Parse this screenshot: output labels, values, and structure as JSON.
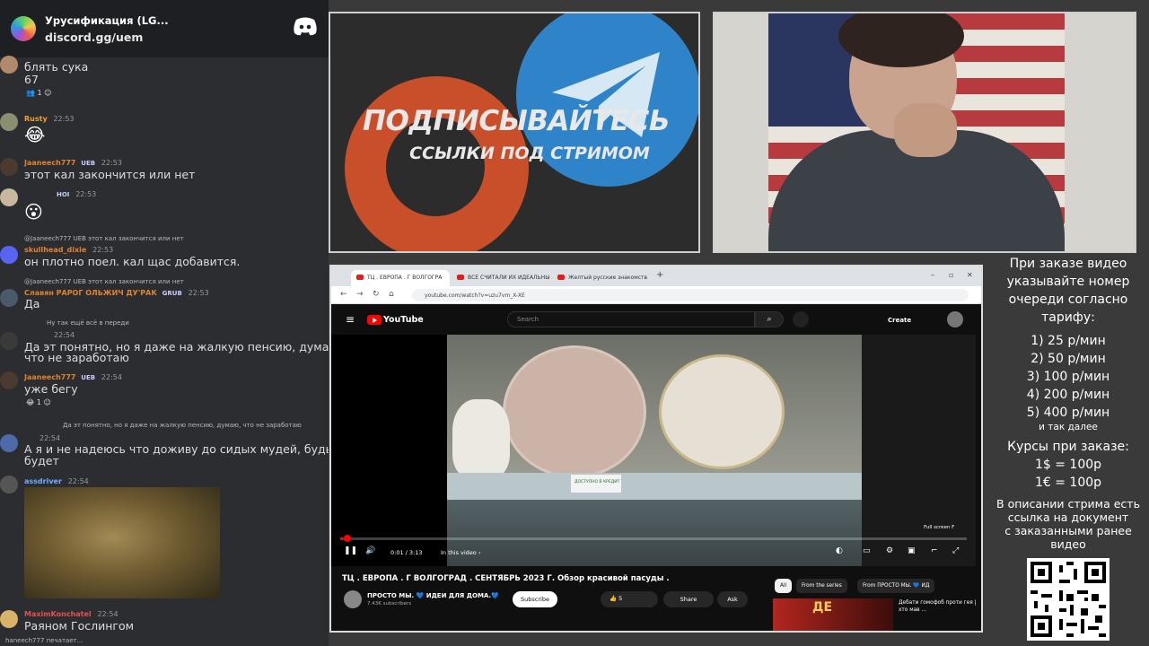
{
  "chat": {
    "server_name": "Урусификация (LG...",
    "server_link": "discord.gg/uem",
    "messages": [
      {
        "text1": "блять сука",
        "text2": "67",
        "react_count": "1"
      },
      {
        "author": "Rusty",
        "author_color": "#f0a030",
        "time": "22:53",
        "emoji": "😂"
      },
      {
        "author": "Jaaneech777",
        "badge": "UEB",
        "author_color": "#e0832f",
        "time": "22:53",
        "text": "этот кал закончится или нет"
      },
      {
        "badge": "HOI",
        "time": "22:53",
        "emoji": "😮"
      },
      {
        "reply": "@Jaaneech777 UEB этот кал закончится или нет",
        "author": "skullhead_dixie",
        "author_color": "#e0832f",
        "time": "22:53",
        "text": "он плотно поел. кал щас добавится."
      },
      {
        "reply": "@Jaaneech777 UEB этот кал закончится или нет",
        "author": "Славян РАРОГ ОЛЬЖИЧ ДУ'РАК",
        "badge": "GRUB",
        "author_color": "#e0832f",
        "time": "22:53",
        "text": "Да"
      },
      {
        "reply": "Ну так ещё всё в переди",
        "time": "22:54",
        "text1": "Да эт понятно, но я даже на жалкую пенсию, думаю,",
        "text2": "что не заработаю"
      },
      {
        "author": "Jaaneech777",
        "badge": "UEB",
        "author_color": "#e0832f",
        "time": "22:54",
        "text": "уже бегу",
        "react_count": "1"
      },
      {
        "reply": "Да эт понятно, но я даже на жалкую пенсию, думаю, что не заработаю",
        "time": "22:54",
        "text1": "А я и не надеюсь что доживу до сидых мудей, будь что",
        "text2": "будет"
      },
      {
        "author": "assdriver",
        "author_color": "#6fb0ff",
        "time": "22:54"
      },
      {
        "author": "MaximKonchatel",
        "author_color": "#e55050",
        "time": "22:54",
        "text": "Раяном Гослингом"
      }
    ],
    "typing": "haneech777 печатает..."
  },
  "promo": {
    "title": "ПОДПИСЫВАЙТЕСЬ",
    "subtitle": "ССЫЛКИ ПОД СТРИМОМ"
  },
  "browser": {
    "tabs": [
      "ТЦ . ЕВРОПА . Г ВОЛГОГРА",
      "ВСЕ СЧИТАЛИ ИХ ИДЕАЛЬНЫ",
      "Желтый русские знакомств"
    ],
    "url": "youtube.com/watch?v=uzu7vm_X-XE"
  },
  "youtube": {
    "logo_text": "YouTube",
    "search_placeholder": "Search",
    "create_label": "Create",
    "time": "0:01 / 3:13",
    "chapter": "In this video ›",
    "fullscreen_tip": "Full screen  F",
    "progress": 0.005,
    "video_title": "ТЦ . ЕВРОПА . Г ВОЛГОГРАД . СЕНТЯБРЬ 2023 Г. Обзор красивой пасуды .",
    "channel_name": "ПРОСТО МЫ. 💙 ИДЕИ ДЛЯ ДОМА.💙",
    "channel_subs": "7.43K subscribers",
    "subscribe_label": "Subscribe",
    "like_count": "5",
    "share_label": "Share",
    "ask_label": "Ask",
    "chips": [
      "All",
      "From the series",
      "From ПРОСТО МЫ. 💙 ИД"
    ],
    "rec_thumb_text": "ДЕ",
    "rec_title": "Дебати гомофоб проти гея | хто мав ...",
    "price_tag_text": "ДОСТУПНО В КРЕДИТ"
  },
  "info": {
    "l1": "При заказе видео",
    "l2": "указывайте номер",
    "l3": "очереди согласно",
    "l4": "тарифу:",
    "t1": "1) 25 р/мин",
    "t2": "2) 50 р/мин",
    "t3": "3) 100 р/мин",
    "t4": "4) 200 р/мин",
    "t5": "5) 400 р/мин",
    "etc": "и так далее",
    "rates_title": "Курсы при заказе:",
    "rate1": "1$ = 100р",
    "rate2": "1€ = 100р",
    "d1": "В описании стрима есть",
    "d2": "ссылка на документ",
    "d3": "с заказанными ранее",
    "d4": "видео"
  },
  "colors": {
    "chat_bg": "#2b2d31",
    "yt_red": "#ff0000",
    "promo_orange": "#c94f2a",
    "promo_blue": "#2f84c9"
  }
}
